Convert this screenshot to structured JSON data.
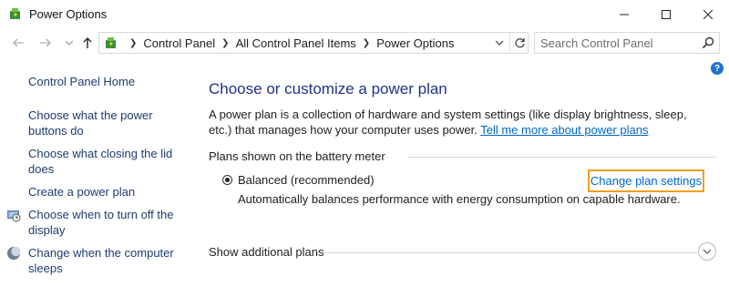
{
  "window": {
    "title": "Power Options"
  },
  "address": {
    "breadcrumbs": [
      "Control Panel",
      "All Control Panel Items",
      "Power Options"
    ],
    "search_placeholder": "Search Control Panel"
  },
  "help": {
    "label": "?"
  },
  "sidebar": {
    "home": "Control Panel Home",
    "items": [
      {
        "label": "Choose what the power buttons do"
      },
      {
        "label": "Choose what closing the lid does"
      },
      {
        "label": "Create a power plan"
      },
      {
        "label": "Choose when to turn off the display",
        "icon": "display-timer-icon"
      },
      {
        "label": "Change when the computer sleeps",
        "icon": "sleep-moon-icon"
      }
    ]
  },
  "main": {
    "title": "Choose or customize a power plan",
    "description": "A power plan is a collection of hardware and system settings (like display brightness, sleep, etc.) that manages how your computer uses power.",
    "description_link": "Tell me more about power plans",
    "plans_section_label": "Plans shown on the battery meter",
    "plan": {
      "name": "Balanced (recommended)",
      "description": "Automatically balances performance with energy consumption on capable hardware.",
      "change_link": "Change plan settings",
      "selected": true
    },
    "more_plans_label": "Show additional plans"
  },
  "colors": {
    "title_blue": "#1e3287",
    "link_blue": "#0066cc",
    "highlight_orange": "#f0a01e",
    "help_blue": "#1e73d0"
  }
}
